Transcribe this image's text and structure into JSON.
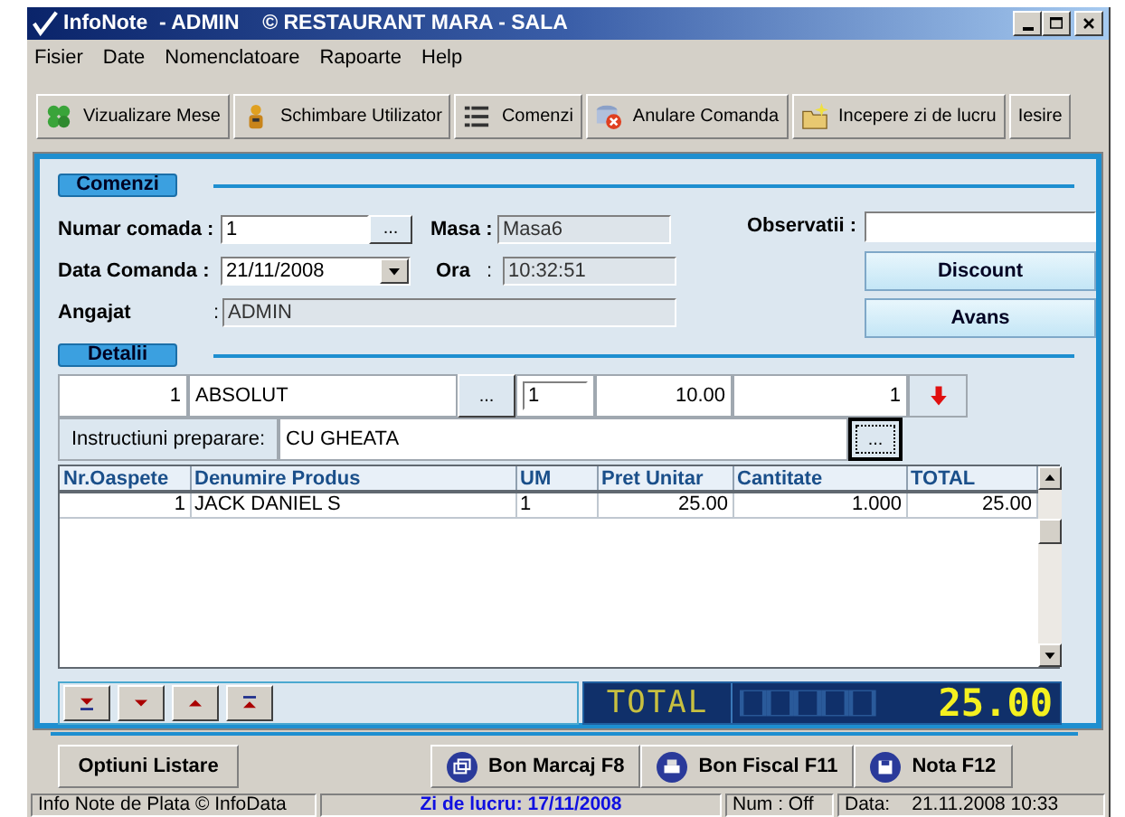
{
  "window": {
    "title": "InfoNote  - ADMIN    © RESTAURANT MARA - SALA"
  },
  "menu": [
    "Fisier",
    "Date",
    "Nomenclatoare",
    "Rapoarte",
    "Help"
  ],
  "toolbar": [
    "Vizualizare Mese",
    "Schimbare Utilizator",
    "Comenzi",
    "Anulare Comanda",
    "Incepere zi de lucru",
    "Iesire"
  ],
  "comenzi": {
    "header": "Comenzi",
    "numar_label": "Numar comada :",
    "numar_value": "1",
    "numar_button": "...",
    "masa_label": "Masa :",
    "masa_value": "Masa6",
    "data_label": "Data Comanda :",
    "data_value": "21/11/2008",
    "ora_label": "Ora",
    "ora_colon": ":",
    "ora_value": "10:32:51",
    "angajat_label": "Angajat",
    "angajat_colon": ":",
    "angajat_value": "ADMIN",
    "observatii_label": "Observatii :",
    "buttons": [
      "Discount",
      "Avans"
    ]
  },
  "detalii": {
    "header": "Detalii",
    "entry": {
      "guest": "1",
      "product": "ABSOLUT",
      "product_button": "...",
      "um": "1",
      "price": "10.00",
      "quantity": "1"
    },
    "instructions_label": "Instructiuni preparare:",
    "instructions_value": "CU GHEATA",
    "instructions_button": "...",
    "table": {
      "columns": [
        "Nr.Oaspete",
        "Denumire Produs",
        "UM",
        "Pret Unitar",
        "Cantitate",
        "TOTAL"
      ],
      "rows": [
        [
          "1",
          "JACK DANIEL S",
          "1",
          "25.00",
          "1.000",
          "25.00"
        ]
      ]
    },
    "total_label": "TOTAL",
    "total_value": "25.00"
  },
  "actions": {
    "left": "Optiuni Listare",
    "right": [
      "Bon Marcaj F8",
      "Bon Fiscal F11",
      "Nota F12"
    ]
  },
  "status_bar": [
    "Info Note de Plata © InfoData",
    "Zi de lucru: 17/11/2008",
    "Num : Off",
    "Data:",
    "21.11.2008 10:33"
  ]
}
